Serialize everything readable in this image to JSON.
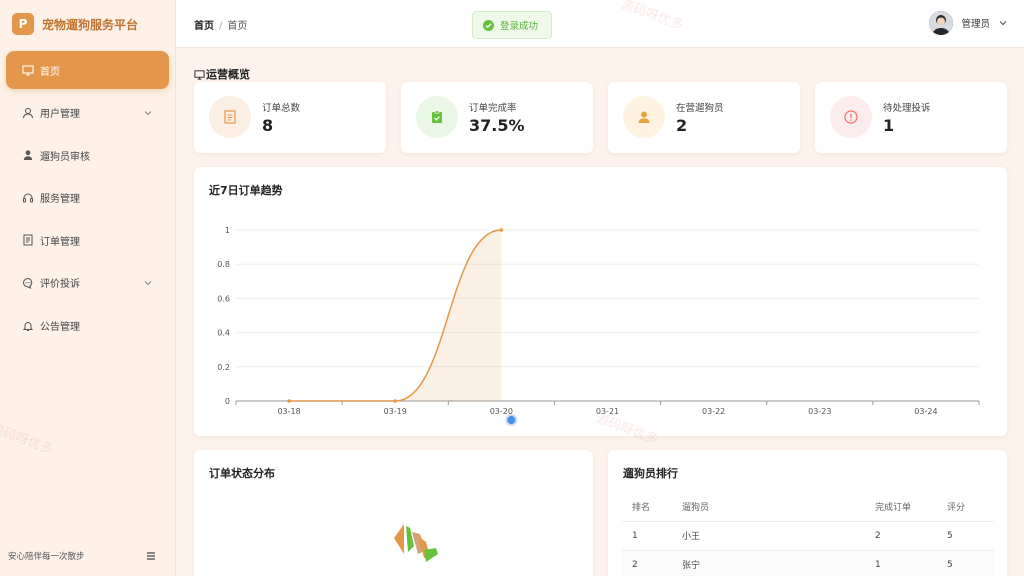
{
  "app": {
    "logo_letter": "P",
    "title": "宠物遛狗服务平台"
  },
  "sidebar": {
    "items": [
      {
        "label": "首页",
        "icon": "monitor-icon",
        "active": true
      },
      {
        "label": "用户管理",
        "icon": "user-icon",
        "has_sub": true
      },
      {
        "label": "遛狗员审核",
        "icon": "avatar-icon"
      },
      {
        "label": "服务管理",
        "icon": "headset-icon"
      },
      {
        "label": "订单管理",
        "icon": "document-icon"
      },
      {
        "label": "评价投诉",
        "icon": "chat-icon",
        "has_sub": true
      },
      {
        "label": "公告管理",
        "icon": "bell-icon"
      }
    ],
    "footer_text": "安心陪伴每一次散步"
  },
  "header": {
    "breadcrumb": [
      "首页",
      "首页"
    ],
    "toast": "登录成功",
    "user_name": "管理员"
  },
  "overview": {
    "title": "运营概览",
    "stats": [
      {
        "label": "订单总数",
        "value": "8",
        "icon": "document-icon",
        "color": "#e4974b"
      },
      {
        "label": "订单完成率",
        "value": "37.5%",
        "icon": "clipboard-check-icon",
        "color": "#67c23a"
      },
      {
        "label": "在营遛狗员",
        "value": "2",
        "icon": "person-icon",
        "color": "#e6a23c"
      },
      {
        "label": "待处理投诉",
        "value": "1",
        "icon": "warning-icon",
        "color": "#f56c6c"
      }
    ]
  },
  "trend": {
    "title": "近7日订单趋势"
  },
  "chart_data": {
    "type": "area",
    "x": [
      "03-18",
      "03-19",
      "03-20",
      "03-21",
      "03-22",
      "03-23",
      "03-24"
    ],
    "y_ticks": [
      "0",
      "0.2",
      "0.4",
      "0.6",
      "0.8",
      "1"
    ],
    "values": [
      0,
      0,
      1,
      null,
      null,
      null,
      null
    ],
    "ylim": [
      0,
      1
    ],
    "color": "#e4974b",
    "grid": true
  },
  "status_dist": {
    "title": "订单状态分布"
  },
  "ranking": {
    "title": "遛狗员排行",
    "columns": [
      "排名",
      "遛狗员",
      "完成订单",
      "评分"
    ],
    "rows": [
      [
        "1",
        "小王",
        "2",
        "5"
      ],
      [
        "2",
        "张宁",
        "1",
        "5"
      ]
    ]
  },
  "watermark": "源码呀优多"
}
